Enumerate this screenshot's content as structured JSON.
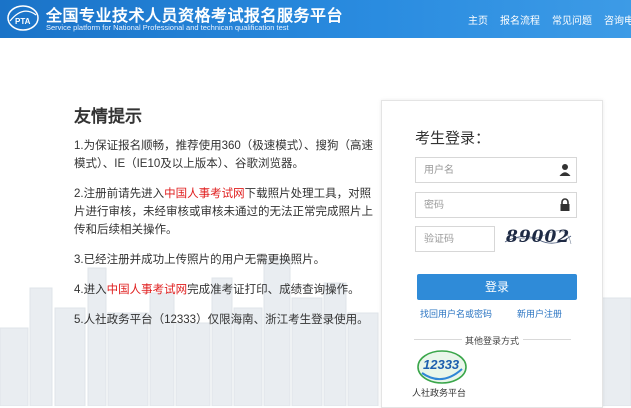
{
  "header": {
    "title": "全国专业技术人员资格考试报名服务平台",
    "subtitle": "Service platform for National Professional and technican qualification test",
    "logo_text": "PTA",
    "nav": [
      "主页",
      "报名流程",
      "常见问题",
      "咨询电话"
    ]
  },
  "notice": {
    "title": "友情提示",
    "item1": "1.为保证报名顺畅，推荐使用360（极速模式）、搜狗（高速模式）、IE（IE10及以上版本）、谷歌浏览器。",
    "item2_pre": "2.注册前请先进入",
    "item2_link": "中国人事考试网",
    "item2_post": "下载照片处理工具，对照片进行审核，未经审核或审核未通过的无法正常完成照片上传和后续相关操作。",
    "item3": "3.已经注册并成功上传照片的用户无需更换照片。",
    "item4_pre": "4.进入",
    "item4_link": "中国人事考试网",
    "item4_post": "完成准考证打印、成绩查询操作。",
    "item5": "5.人社政务平台（12333）仅限海南、浙江考生登录使用。"
  },
  "login": {
    "title": "考生登录：",
    "username_placeholder": "用户名",
    "password_placeholder": "密码",
    "captcha_placeholder": "验证码",
    "captcha_code": "89002",
    "login_button": "登录",
    "forgot_link": "找回用户名或密码",
    "register_link": "新用户注册",
    "other_methods": "其他登录方式",
    "sheb_logo_text": "12333",
    "sheb_label": "人社政务平台"
  },
  "colors": {
    "header_blue": "#1a73c8",
    "button_blue": "#2f8bd8",
    "link_red": "#e01e1e",
    "link_blue": "#2a74c2"
  }
}
